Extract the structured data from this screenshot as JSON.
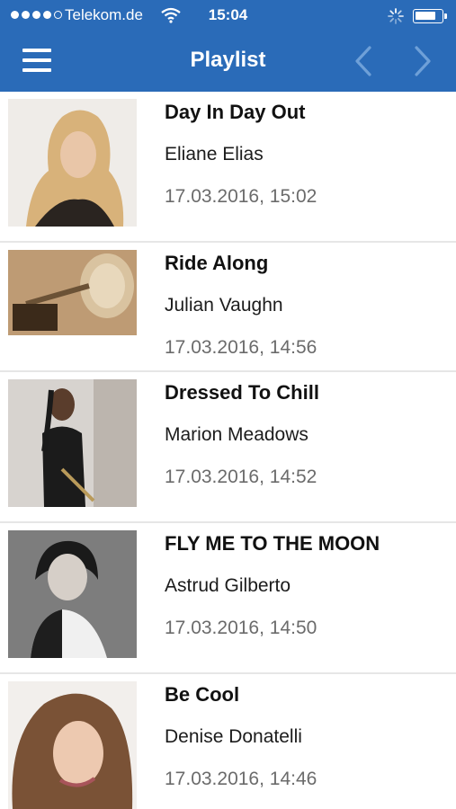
{
  "status": {
    "carrier": "Telekom.de",
    "time": "15:04"
  },
  "navbar": {
    "title": "Playlist"
  },
  "playlist": [
    {
      "title": "Day In Day Out",
      "artist": "Eliane Elias",
      "played": "17.03.2016, 15:02"
    },
    {
      "title": "Ride Along",
      "artist": "Julian Vaughn",
      "played": "17.03.2016, 14:56"
    },
    {
      "title": "Dressed To Chill",
      "artist": "Marion Meadows",
      "played": "17.03.2016, 14:52"
    },
    {
      "title": "FLY ME TO THE MOON",
      "artist": "Astrud Gilberto",
      "played": "17.03.2016, 14:50"
    },
    {
      "title": "Be Cool",
      "artist": "Denise Donatelli",
      "played": "17.03.2016, 14:46"
    }
  ],
  "colors": {
    "accent": "#2a6bb8"
  }
}
